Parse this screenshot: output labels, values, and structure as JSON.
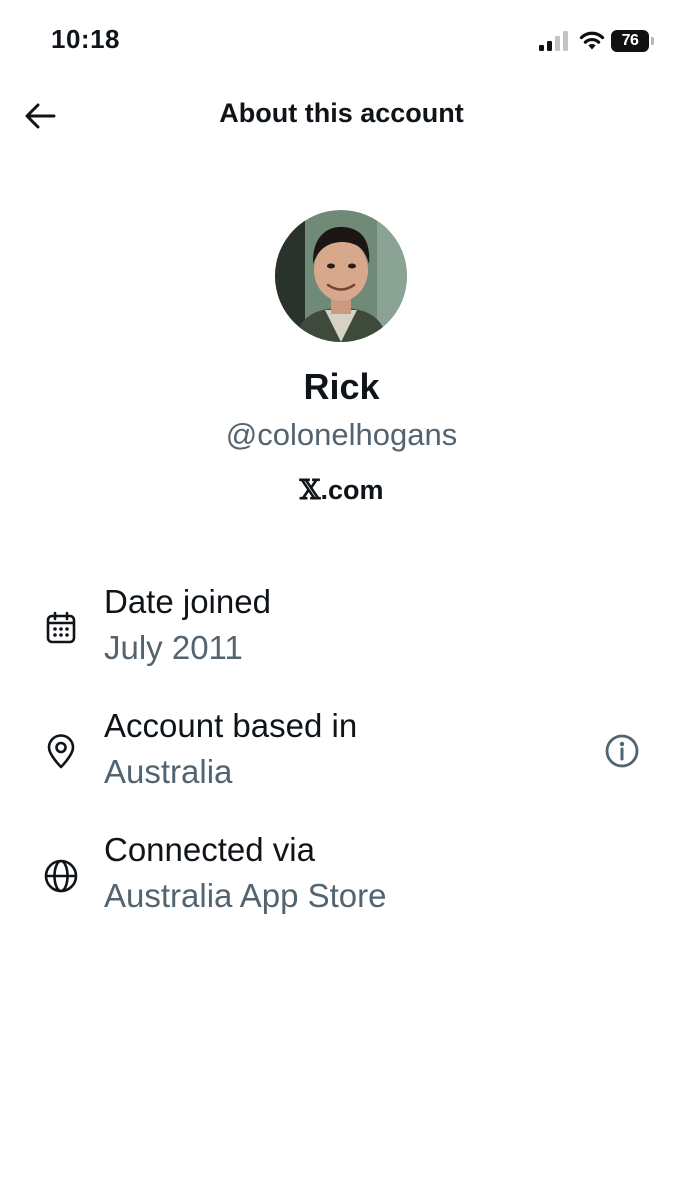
{
  "status_bar": {
    "time": "10:18",
    "battery_level": "76",
    "icons": [
      "cellular-signal-icon",
      "wifi-icon",
      "battery-icon"
    ]
  },
  "header": {
    "title": "About this account",
    "back_icon": "arrow-left-icon"
  },
  "profile": {
    "name": "Rick",
    "handle": "@colonelhogans",
    "domain_prefix": "𝕏",
    "domain_suffix": ".com"
  },
  "details": [
    {
      "icon": "calendar-icon",
      "label": "Date joined",
      "value": "July 2011"
    },
    {
      "icon": "location-pin-icon",
      "label": "Account based in",
      "value": "Australia",
      "action_icon": "info-icon"
    },
    {
      "icon": "globe-icon",
      "label": "Connected via",
      "value": "Australia App Store"
    }
  ],
  "colors": {
    "text_primary": "#0f1419",
    "text_secondary": "#536471",
    "background": "#ffffff"
  }
}
